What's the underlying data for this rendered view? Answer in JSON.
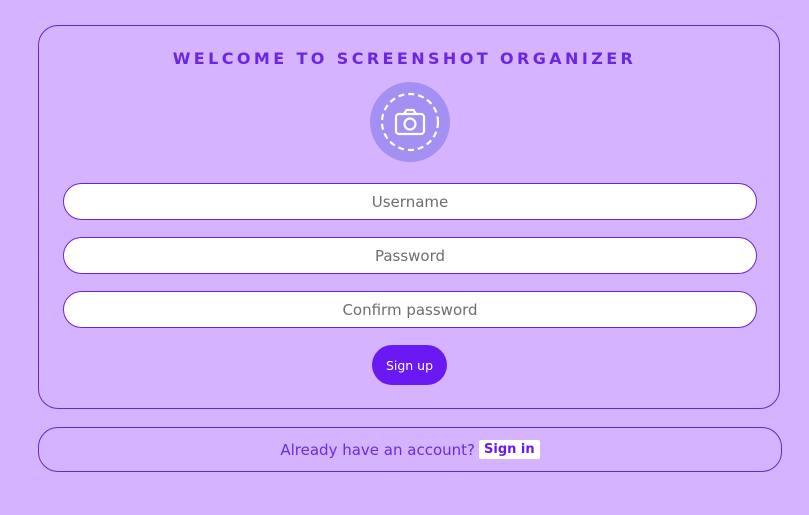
{
  "signup_form": {
    "title": "WELCOME TO SCREENSHOT ORGANIZER",
    "logo_icon": "dashed-camera-icon",
    "username": {
      "placeholder": "Username",
      "value": ""
    },
    "password": {
      "placeholder": "Password",
      "value": ""
    },
    "confirm_password": {
      "placeholder": "Confirm password",
      "value": ""
    },
    "submit_label": "Sign up"
  },
  "signin_prompt": {
    "text": "Already have an account?",
    "link_label": "Sign in"
  },
  "colors": {
    "background": "#d5b3ff",
    "accent": "#6b19f2",
    "title": "#6b26e3",
    "logo_circle": "#a48ff3",
    "border": "#6a24d8"
  }
}
